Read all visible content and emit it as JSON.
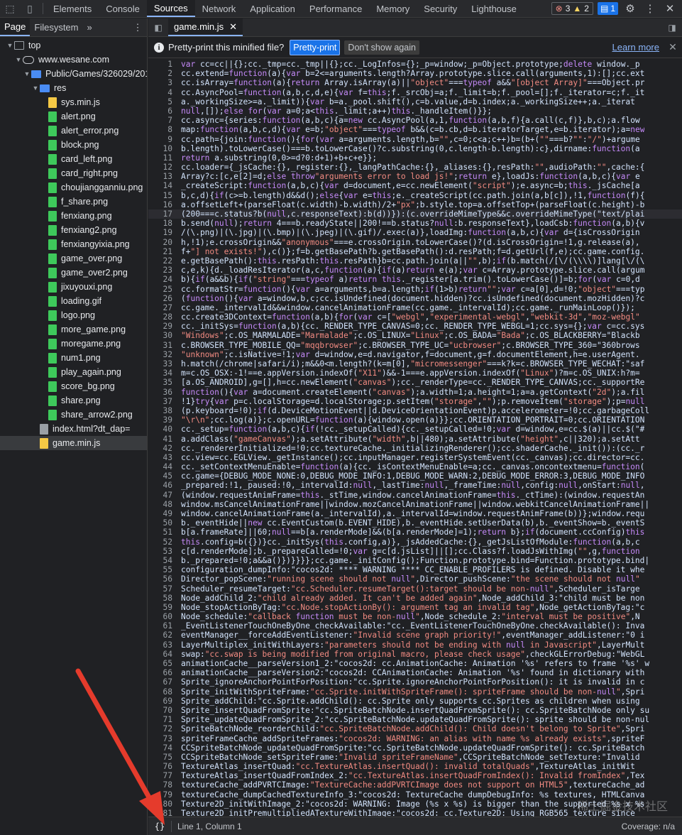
{
  "topbar": {
    "tabs": [
      "Elements",
      "Console",
      "Sources",
      "Network",
      "Application",
      "Performance",
      "Memory",
      "Security",
      "Lighthouse"
    ],
    "active_tab": "Sources",
    "errors": "3",
    "warnings": "2",
    "messages": "1"
  },
  "navigator": {
    "tabs": [
      "Page",
      "Filesystem"
    ],
    "more": "»",
    "tree": {
      "top": "top",
      "domain": "www.wesane.com",
      "folder": "Public/Games/326029/201",
      "res": "res",
      "files": [
        "sys.min.js",
        "alert.png",
        "alert_error.png",
        "block.png",
        "card_left.png",
        "card_right.png",
        "choujiangganniu.png",
        "f_share.png",
        "fenxiang.png",
        "fenxiang2.png",
        "fenxiangyixia.png",
        "game_over.png",
        "game_over2.png",
        "jixuyouxi.png",
        "loading.gif",
        "logo.png",
        "more_game.png",
        "moregame.png",
        "num1.png",
        "play_again.png",
        "score_bg.png",
        "share.png",
        "share_arrow2.png"
      ],
      "index": "index.html?dt_dap=",
      "game": "game.min.js"
    }
  },
  "editor": {
    "file_tab": "game.min.js",
    "info_text": "Pretty-print this minified file?",
    "pretty_print": "Pretty-print",
    "dont_show": "Don't show again",
    "learn_more": "Learn more",
    "lines": [
      "var cc=cc||{};cc._tmp=cc._tmp||{};cc._LogInfos={};_p=window;_p=Object.prototype;delete window._p",
      "cc.extend=function(a){var b=2<=arguments.length?Array.prototype.slice.call(arguments,1):[];cc.ext",
      "cc.isArray=function(a){return Array.isArray(a)||\"object\"===typeof a&&\"[object Array]\"===Object.pr",
      "cc.AsyncPool=function(a,b,c,d,e){var f=this;f._srcObj=a;f._limit=b;f._pool=[];f._iterator=c;f._it",
      "a._workingSize>=a._limit)){var b=a._pool.shift(),c=b.value,d=b.index;a._workingSize++;a._iterat",
      "null,[]);else for(var a=0;a<this._limit;a++)this._handleItem()}};",
      "cc.async={series:function(a,b,c){a=new cc.AsyncPool(a,1,function(a,b,f){a.call(c,f)},b,c);a.flow",
      "map:function(a,b,c,d){var e=b;\"object\"===typeof b&&(c=b.cb,d=b.iteratorTarget,e=b.iterator);a=new",
      "cc.path={join:function(){for(var a=arguments.length,b=\"\",c=0;c<a;c++)b=(b+(\"\"===b?\"\":\"/\")+argume",
      "b.length).toLowerCase()===b.toLowerCase()?c.substring(0,c.length-b.length):c},dirname:function(a",
      "return a.substring(0,0>=d?0:d+1)+b+c+e}};",
      "cc.loader={_jsCache:{},_register:{},_langPathCache:{},_aliases:{},resPath:\"\",audioPath:\"\",cache:{",
      "Array?c:[c,e[2]=d;else throw\"arguments error to load js!\";return e},loadJs:function(a,b,c){var e",
      "_createScript:function(a,b,c){var d=document,e=cc.newElement(\"script\");e.async=b;this._jsCache[a",
      "b,c,d){if(c>=b.length)d&&d();else{var e=this;e._createScript(cc.path.join(a,b[c]),!1,function(f){",
      "a.offsetLeft+(parseFloat(c.width)-b.width)/2+\"px\";b.style.top=a.offsetTop+(parseFloat(c.height)-b",
      "(200===c.status?b(null,c.responseText):b(d))}):(c.overrideMimeType&&c.overrideMimeType(\"text/plai",
      "b.send(null);return 4===b.readyState||200!==b.status?null:b.responseText},loadCsb:function(a,b){v",
      "/(\\.png)|(\\.jpg)|(\\.bmp)|(\\.jpeg)|(\\.gif)/.exec(a)},loadImg:function(a,b,c){var d={isCrossOrigin",
      "h,!1);e.crossOrigin&&\"anonymous\"===e.crossOrigin.toLowerCase()?(d.isCrossOrigin=!1,g.release(a),",
      "f+\"] not exists!\"),c()};f=b.getBasePath?b.getBasePath():d.resPath;f=d.getUrl(f,e);cc.game.config.",
      "e.getBasePath():this.resPath:this.resPath}b=cc.path.join(a||\"\",b);if(b.match(/[\\/(\\\\\\\\)]lang[\\/(\\",
      "c,e,k){d._loadResIterator(a,c,function(a){if(a)return e(a);var c=Array.prototype.slice.call(argum",
      "b){if(a&&b){if(\"string\"===typeof a)return this._register[a.trim().toLowerCase()]=b;for(var c=0,d",
      "cc.formatStr=function(){var a=arguments,b=a.length;if(1>b)return\"\";var c=a[0],d=!0;\"object\"===typ",
      "(function(){var a=window,b,c;cc.isUndefined(document.hidden)?cc.isUndefined(document.mozHidden)?c",
      "cc.game._intervalId&&window.cancelAnimationFrame(cc.game._intervalId);cc.game._runMainLoop()});",
      "cc.create3DContext=function(a,b){for(var c=[\"webgl\",\"experimental-webgl\",\"webkit-3d\",\"moz-webgl\"",
      "cc._initSys=function(a,b){cc._RENDER_TYPE_CANVAS=0;cc._RENDER_TYPE_WEBGL=1;cc.sys={};var c=cc.sys",
      "\"Windows\";c.OS_MARMALADE=\"Marmalade\";c.OS_LINUX=\"Linux\";c.OS_BADA=\"Bada\";c.OS_BLACKBERRY=\"Blackb",
      "c.BROWSER_TYPE_MOBILE_QQ=\"mqqbrowser\";c.BROWSER_TYPE_UC=\"ucbrowser\";c.BROWSER_TYPE_360=\"360brows",
      "\"unknown\";c.isNative=!1;var d=window,e=d.navigator,f=document,g=f.documentElement,h=e.userAgent.",
      "h.match(/chrome|safari/i);m&&0<m.length?(k=m[0],\"micromessenger\"===k?k=c.BROWSER_TYPE_WECHAT:\"saf",
      "m=c.OS_OSX:-1!==e.appVersion.indexOf(\"X11\")&&-1===e.appVersion.indexOf(\"Linux\")?m=c.OS_UNIX:h?m=",
      "[a.OS_ANDROID],g=[],h=cc.newElement(\"canvas\");cc._renderType=cc._RENDER_TYPE_CANVAS;cc._supportRe",
      "function(){var a=document.createElement(\"canvas\");a.width=1;a.height=1;a=a.getContext(\"2d\");a.fil",
      "!1}try{var p=c.localStorage=d.localStorage;p.setItem(\"storage\",\"\");p.removeItem(\"storage\");p=null",
      "(p.keyboard=!0);if(d.DeviceMotionEvent||d.DeviceOrientationEvent)p.accelerometer=!0;cc.garbageColl",
      "\"\\r\\n\";cc.log(a)};c.openURL=function(a){window.open(a)}};cc.ORIENTATION_PORTRAIT=0;cc.ORIENTATION",
      "cc._setup=function(a,b,c){if(!cc._setupCalled){cc._setupCalled=!0;var d=window,e=cc.$(a)||cc.$(\"#",
      "a.addClass(\"gameCanvas\");a.setAttribute(\"width\",b||480);a.setAttribute(\"height\",c||320);a.setAtt",
      "cc._rendererInitialized=!0;cc.textureCache._initializingRenderer();cc.shaderCache._init()):(cc._r",
      "cc.view=cc.EGLView._getInstance();cc.inputManager.registerSystemEvent(cc._canvas);cc.director=cc.",
      "cc._setContextMenuEnable=function(a){cc._isContextMenuEnable=a;cc._canvas.oncontextmenu=function(",
      "cc.game={DEBUG_MODE_NONE:0,DEBUG_MODE_INFO:1,DEBUG_MODE_WARN:2,DEBUG_MODE_ERROR:3,DEBUG_MODE_INFO",
      "_prepared:!1,_paused:!0,_intervalId:null,_lastTime:null,_frameTime:null,config:null,onStart:null,",
      "(window.requestAnimFrame=this._stTime,window.cancelAnimationFrame=this._ctTime):(window.requestAn",
      "window.msCancelAnimationFrame||window.mozCancelAnimationFrame||window.webkitCancelAnimationFrame||",
      "window.cancelAnimationFrame(a._intervalId),a._intervalId=window.requestAnimFrame(b))};window.requ",
      "b._eventHide||new cc.EventCustom(b.EVENT_HIDE),b._eventHide.setUserData(b),b._eventShow=b._eventS",
      "b[a.frameRate]||60;null==b[a.renderMode]&&(b[a.renderMode]=1);return b};if(document.ccConfig)this",
      "this.config=b({})}cc._initSys(this.config,a)},_jsAddedCache:{},_getJsListOfModule:function(a,b,c",
      "c[d.renderMode];b._prepareCalled=!0;var g=c[d.jsList]||[];cc.Class?f.loadJsWithImg(\"\",g,function",
      "b._prepared=!0;a&&a()})}}}};cc.game._initConfig();Function.prototype.bind=Function.prototype.bind|",
      "configuration_dumpInfo:\"cocos2d: **** WARNING **** CC_ENABLE_PROFILERS is defined. Disable it whe",
      "Director_popScene:\"running scene should not null\",Director_pushScene:\"the scene should not null\"",
      "Scheduler_resumeTarget:\"cc.Scheduler.resumeTarget():target should be non-null\",Scheduler_isTarge",
      "Node_addChild_2:\"child already added. It can't be added again\",Node_addChild_3:\"child must be non",
      "Node_stopActionByTag:\"cc.Node.stopActionBy(): argument tag an invalid tag\",Node_getActionByTag:\"c",
      "Node_schedule:\"callback function must be non-null\",Node_schedule_2:\"interval must be positive\",N",
      "_EventListenerTouchOneByOne_checkAvailable:\"cc._EventListenerTouchOneByOne.checkAvailable(): Inva",
      "eventManager__forceAddEventListener:\"Invalid scene graph priority!\",eventManager_addListener:\"0 i",
      "LayerMultiplex_initWithLayers:\"parameters should not be ending with null in Javascript\",LayerMult",
      "swap:\"cc.swap is being modified from original macro, please check usage\",checkGLErrorDebug:\"WebGL",
      "animationCache__parseVersion1_2:\"cocos2d: cc.AnimationCache: Animation '%s' refers to frame '%s' w",
      "animationCache__parseVersion2:\"cocos2d: CCAnimationCache: Animation '%s' found in dictionary with",
      "Sprite_ignoreAnchorPointForPosition:\"cc.Sprite.ignoreAnchorPointForPosition(): it is invalid in c",
      "Sprite_initWithSpriteFrame:\"cc.Sprite.initWithSpriteFrame(): spriteFrame should be non-null\",Spri",
      "Sprite_addChild:\"cc.Sprite.addChild(): cc.Sprite only supports cc.Sprites as children when using",
      "Sprite_insertQuadFromSprite:\"cc.SpriteBatchNode.insertQuadFromSprite(): cc.SpriteBatchNode only su",
      "Sprite_updateQuadFromSprite_2:\"cc.SpriteBatchNode.updateQuadFromSprite(): sprite should be non-nul",
      "SpriteBatchNode_reorderChild:\"cc.SpriteBatchNode.addChild(): Child doesn't belong to Sprite\",Spri",
      "spriteFrameCache_addSpriteFrames:\"cocos2d: WARNING: an alias with name %s already exists\",spriteF",
      "CCSpriteBatchNode_updateQuadFromSprite:\"cc.SpriteBatchNode.updateQuadFromSprite(): cc.SpriteBatch",
      "CCSpriteBatchNode_setSpriteFrame:\"Invalid spriteFrameName\",CCSpriteBatchNode_setTexture:\"Invalid",
      "TextureAtlas_insertQuad:\"cc.TextureAtlas.insertQuad(): invalid totalQuads\",TextureAtlas_initWit",
      "TextureAtlas_insertQuadFromIndex_2:\"cc.TextureAtlas.insertQuadFromIndex(): Invalid fromIndex\",Tex",
      "textureCache_addPVRTCImage:\"TextureCache:addPVRTCImage does not support on HTML5\",textureCache_ad",
      "textureCache_dumpCachedTextureInfo_3:\"cocos2d: TextureCache dumpDebugInfo: %s textures, HTMLCanva",
      "Texture2D_initWithImage_2:\"cocos2d: WARNING: Image (%s x %s) is bigger than the supported %s x %s",
      "Texture2D_initPremultipliedATextureWithImage:\"cocos2d: cc.Texture2D: Using RGB565 texture since",
      ""
    ]
  },
  "status": {
    "pretty_icon": "{}",
    "position": "Line 1, Column 1",
    "coverage": "Coverage: n/a"
  },
  "watermark": "稀土掘金技术社区",
  "colors": {
    "accent": "#8ab4f8",
    "primary_button": "#1a73e8",
    "png_icon": "#3ec95b",
    "js_icon": "#f5c945",
    "arrow": "#e53b2c"
  }
}
